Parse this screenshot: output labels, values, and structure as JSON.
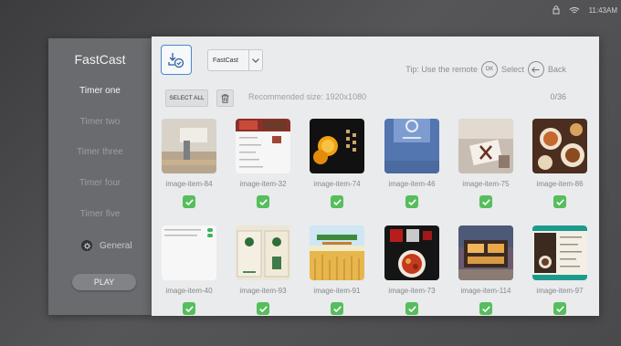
{
  "status_bar": {
    "time": "11:43AM",
    "icons": [
      "lock-icon",
      "wifi-icon"
    ]
  },
  "sidebar": {
    "title": "FastCast",
    "timers": [
      {
        "label": "Timer one",
        "active": true
      },
      {
        "label": "Timer two",
        "active": false
      },
      {
        "label": "Timer three",
        "active": false
      },
      {
        "label": "Timer four",
        "active": false
      },
      {
        "label": "Timer five",
        "active": false
      }
    ],
    "general_label": "General",
    "play_label": "PLAY"
  },
  "toolbar": {
    "source_value": "FastCast",
    "hint_prefix": "Tip: Use the remote",
    "ok_badge": "OK",
    "select_label": "Select",
    "back_label": "Back",
    "select_all_label": "SELECT ALL",
    "recommended_size": "Recommended size: 1920x1080",
    "selection_count": "0/36"
  },
  "gallery": {
    "items": [
      {
        "label": "image-item-84",
        "thumbnail": "sewing-machine-photo",
        "checked": true
      },
      {
        "label": "image-item-32",
        "thumbnail": "food-menu-screenshot",
        "checked": true
      },
      {
        "label": "image-item-74",
        "thumbnail": "orange-poster",
        "checked": true
      },
      {
        "label": "image-item-46",
        "thumbnail": "blue-device-photo",
        "checked": true
      },
      {
        "label": "image-item-75",
        "thumbnail": "gift-box-photo",
        "checked": true
      },
      {
        "label": "image-item-86",
        "thumbnail": "food-spread-photo",
        "checked": true
      },
      {
        "label": "image-item-40",
        "thumbnail": "settings-list-screenshot",
        "checked": true
      },
      {
        "label": "image-item-93",
        "thumbnail": "tea-package-design",
        "checked": true
      },
      {
        "label": "image-item-91",
        "thumbnail": "wheat-field-banner",
        "checked": true
      },
      {
        "label": "image-item-73",
        "thumbnail": "sichuan-dish-poster",
        "checked": true
      },
      {
        "label": "image-item-114",
        "thumbnail": "modern-house-photo",
        "checked": true
      },
      {
        "label": "image-item-97",
        "thumbnail": "coffee-menu-design",
        "checked": true
      }
    ]
  },
  "colors": {
    "accent": "#4a86d4",
    "check": "#56be5c",
    "panel": "#e9ebec",
    "sidebar": "#6a6b6e"
  }
}
